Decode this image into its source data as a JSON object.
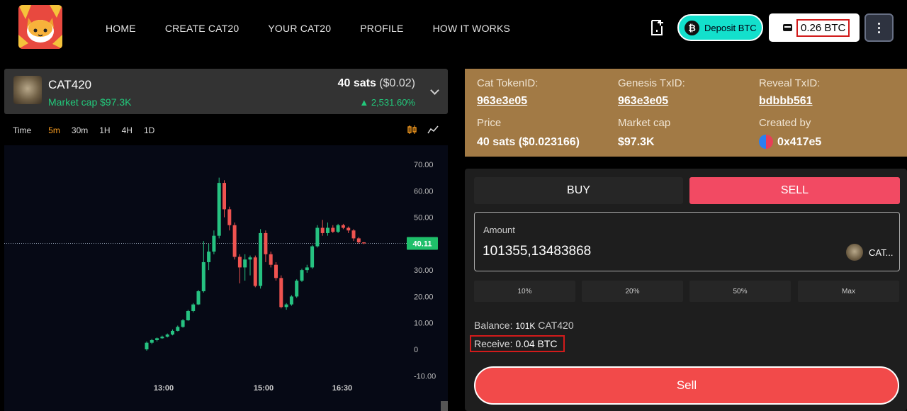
{
  "nav": [
    "HOME",
    "CREATE CAT20",
    "YOUR CAT20",
    "PROFILE",
    "HOW IT WORKS"
  ],
  "header": {
    "deposit_label": "Deposit BTC",
    "btc_symbol": "₿",
    "balance": "0.26 BTC"
  },
  "token": {
    "name": "CAT420",
    "market_cap": "Market cap $97.3K",
    "price": "40 sats",
    "price_usd": "($0.02)",
    "change": "▲ 2,531.60%"
  },
  "timeframes": {
    "label": "Time",
    "options": [
      "5m",
      "30m",
      "1H",
      "4H",
      "1D"
    ],
    "active": "5m"
  },
  "info": {
    "token_id_label": "Cat TokenID:",
    "token_id": "963e3e05",
    "genesis_label": "Genesis TxID:",
    "genesis": "963e3e05",
    "reveal_label": "Reveal TxID:",
    "reveal": "bdbbb561",
    "price_label": "Price",
    "price": "40 sats ($0.023166)",
    "mcap_label": "Market cap",
    "mcap": "$97.3K",
    "created_label": "Created by",
    "creator": "0x417e5"
  },
  "trade": {
    "buy_tab": "BUY",
    "sell_tab": "SELL",
    "amount_label": "Amount",
    "amount_value": "101355,13483868",
    "amount_token": "CAT...",
    "pct_buttons": [
      "10%",
      "20%",
      "50%",
      "Max"
    ],
    "balance_label": "Balance:",
    "balance_value": "101K",
    "balance_token": "CAT420",
    "receive_label": "Receive:",
    "receive_value": "0.04 BTC",
    "sell_button": "Sell"
  },
  "colors": {
    "up": "#26c281",
    "down": "#ef5350",
    "sell": "#f24a63",
    "info_bg": "#a27a45",
    "deposit": "#13e0cc"
  },
  "chart_data": {
    "type": "candlestick",
    "y_ticks": [
      "70.00",
      "60.00",
      "50.00",
      "40.00",
      "30.00",
      "20.00",
      "10.00",
      "0",
      "-10.00"
    ],
    "x_ticks": [
      "13:00",
      "15:00",
      "16:30"
    ],
    "ylim": [
      -10,
      72
    ],
    "current_price": "40.11",
    "candles": [
      {
        "o": 0,
        "c": 2.5,
        "h": 3,
        "l": -0.5
      },
      {
        "o": 2.5,
        "c": 3.5,
        "h": 4,
        "l": 2
      },
      {
        "o": 3.5,
        "c": 4.2,
        "h": 4.5,
        "l": 3
      },
      {
        "o": 4.2,
        "c": 4.8,
        "h": 5.2,
        "l": 4
      },
      {
        "o": 4.8,
        "c": 5.6,
        "h": 6,
        "l": 4.5
      },
      {
        "o": 5.6,
        "c": 7,
        "h": 7.5,
        "l": 5.3
      },
      {
        "o": 7,
        "c": 8.5,
        "h": 9,
        "l": 6.8
      },
      {
        "o": 8.5,
        "c": 11,
        "h": 11.5,
        "l": 8.2
      },
      {
        "o": 11,
        "c": 14.5,
        "h": 15,
        "l": 10.8
      },
      {
        "o": 14.5,
        "c": 17,
        "h": 17.5,
        "l": 14
      },
      {
        "o": 17,
        "c": 22,
        "h": 22.5,
        "l": 16.8
      },
      {
        "o": 22,
        "c": 33,
        "h": 41,
        "l": 21.5
      },
      {
        "o": 33,
        "c": 37,
        "h": 40,
        "l": 30
      },
      {
        "o": 37,
        "c": 43,
        "h": 45,
        "l": 36
      },
      {
        "o": 43,
        "c": 63,
        "h": 65,
        "l": 42
      },
      {
        "o": 63,
        "c": 53,
        "h": 64,
        "l": 50
      },
      {
        "o": 53,
        "c": 47,
        "h": 54,
        "l": 45
      },
      {
        "o": 47,
        "c": 35,
        "h": 48,
        "l": 34
      },
      {
        "o": 35,
        "c": 31,
        "h": 36,
        "l": 25
      },
      {
        "o": 31,
        "c": 34,
        "h": 36,
        "l": 26
      },
      {
        "o": 34,
        "c": 34.8,
        "h": 35.5,
        "l": 28
      },
      {
        "o": 34.8,
        "c": 24,
        "h": 35.5,
        "l": 23.5
      },
      {
        "o": 24,
        "c": 44,
        "h": 45.5,
        "l": 23
      },
      {
        "o": 44,
        "c": 36,
        "h": 45,
        "l": 33
      },
      {
        "o": 36,
        "c": 32,
        "h": 37,
        "l": 31
      },
      {
        "o": 32,
        "c": 27,
        "h": 33,
        "l": 26
      },
      {
        "o": 27,
        "c": 16,
        "h": 28,
        "l": 15.5
      },
      {
        "o": 16,
        "c": 17,
        "h": 17.5,
        "l": 15
      },
      {
        "o": 17,
        "c": 20,
        "h": 20.5,
        "l": 16.5
      },
      {
        "o": 20,
        "c": 26,
        "h": 26.5,
        "l": 19.5
      },
      {
        "o": 26,
        "c": 30,
        "h": 30.5,
        "l": 25.5
      },
      {
        "o": 30,
        "c": 31,
        "h": 32,
        "l": 29
      },
      {
        "o": 31,
        "c": 39,
        "h": 39.5,
        "l": 30.5
      },
      {
        "o": 39,
        "c": 46,
        "h": 47,
        "l": 38.5
      },
      {
        "o": 46,
        "c": 44,
        "h": 49,
        "l": 43
      },
      {
        "o": 44,
        "c": 46,
        "h": 48,
        "l": 43
      },
      {
        "o": 46,
        "c": 44.5,
        "h": 47,
        "l": 44
      },
      {
        "o": 44.5,
        "c": 47,
        "h": 47.5,
        "l": 44
      },
      {
        "o": 47,
        "c": 46,
        "h": 47.5,
        "l": 45.5
      },
      {
        "o": 46,
        "c": 45,
        "h": 46.5,
        "l": 44
      },
      {
        "o": 45,
        "c": 42,
        "h": 45.5,
        "l": 41
      },
      {
        "o": 42,
        "c": 40.5,
        "h": 42.5,
        "l": 40
      },
      {
        "o": 40.5,
        "c": 40.1,
        "h": 40.6,
        "l": 39.8
      }
    ]
  }
}
